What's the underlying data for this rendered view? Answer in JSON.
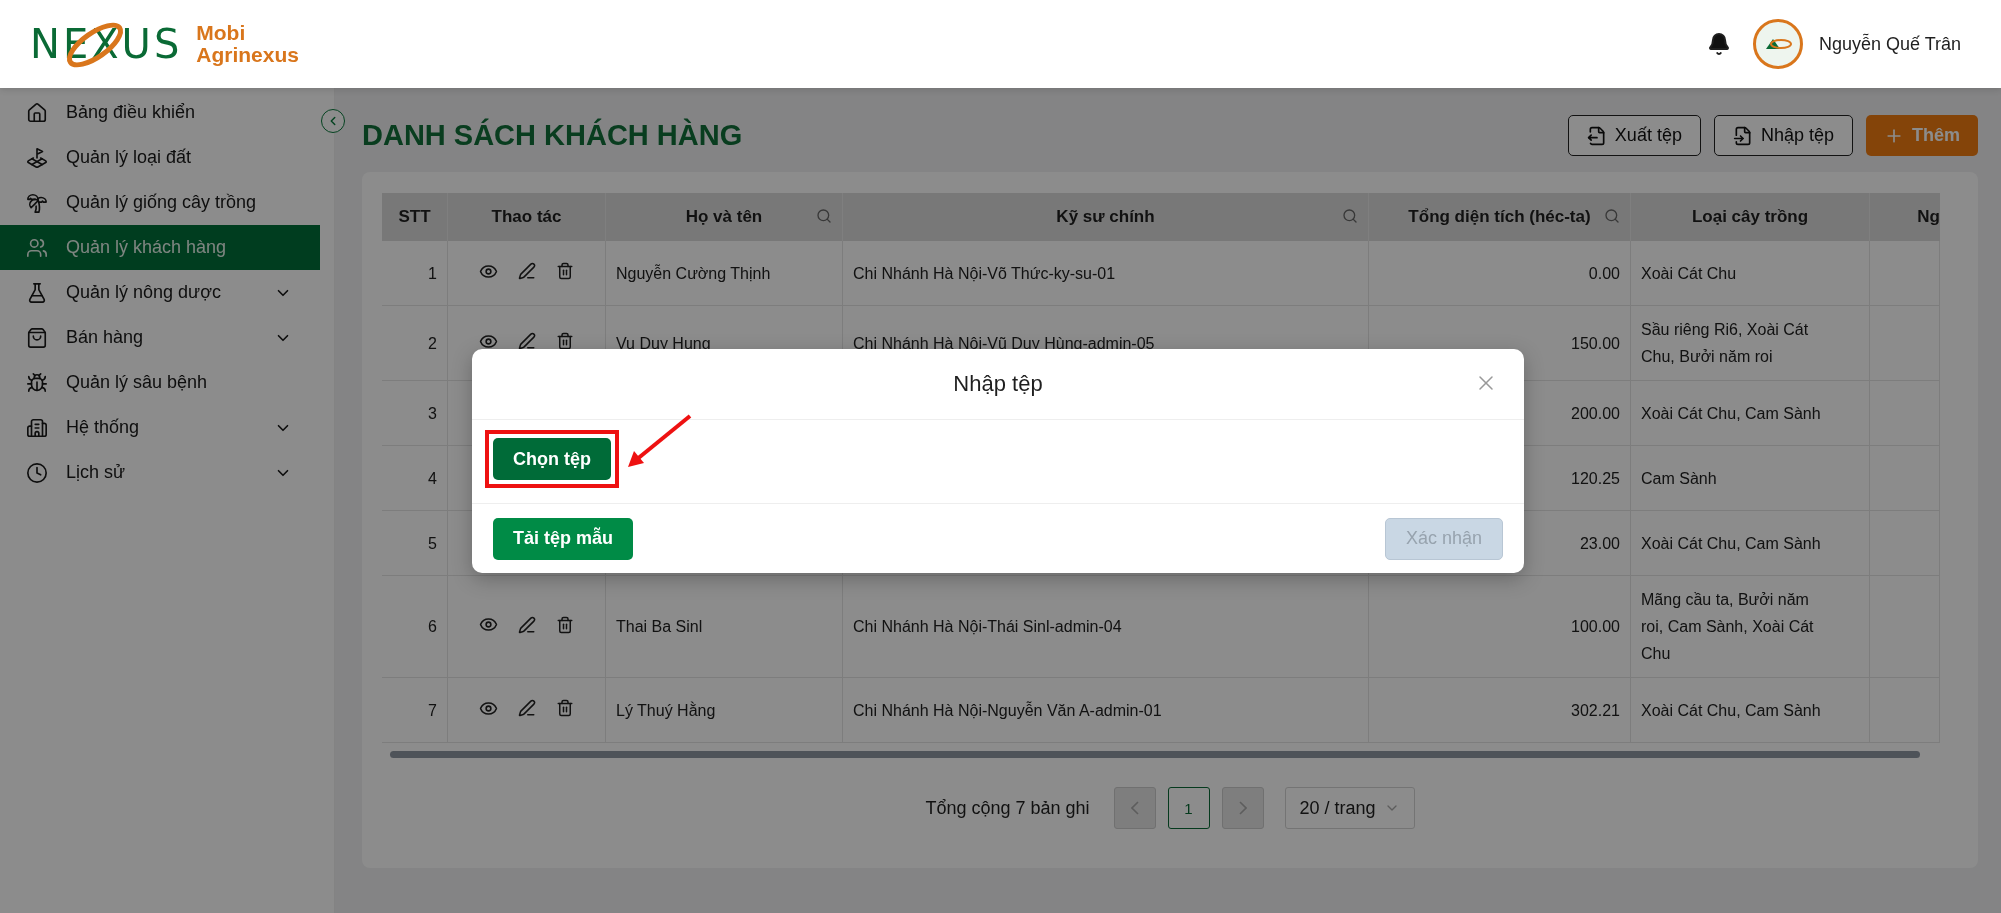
{
  "logo": {
    "wordmark": "NEXUS",
    "brand_line_1": "Mobi",
    "brand_line_2": "Agrinexus"
  },
  "header": {
    "user_name": "Nguyễn Quế Trân"
  },
  "sidebar": {
    "items": [
      {
        "label": "Bảng điều khiển",
        "kind": "home",
        "selected": false,
        "has_submenu": false
      },
      {
        "label": "Quản lý loại đất",
        "kind": "land",
        "selected": false,
        "has_submenu": false
      },
      {
        "label": "Quản lý giống cây trồng",
        "kind": "palm",
        "selected": false,
        "has_submenu": false
      },
      {
        "label": "Quản lý khách hàng",
        "kind": "users",
        "selected": true,
        "has_submenu": false
      },
      {
        "label": "Quản lý nông dược",
        "kind": "flask",
        "selected": false,
        "has_submenu": true
      },
      {
        "label": "Bán hàng",
        "kind": "bag",
        "selected": false,
        "has_submenu": true
      },
      {
        "label": "Quản lý sâu bệnh",
        "kind": "bug",
        "selected": false,
        "has_submenu": false
      },
      {
        "label": "Hệ thống",
        "kind": "building",
        "selected": false,
        "has_submenu": true
      },
      {
        "label": "Lịch sử",
        "kind": "clock",
        "selected": false,
        "has_submenu": true
      }
    ]
  },
  "page": {
    "title": "DANH SÁCH KHÁCH HÀNG",
    "actions": [
      {
        "label": "Xuất tệp",
        "kind": "export"
      },
      {
        "label": "Nhập tệp",
        "kind": "import"
      },
      {
        "label": "Thêm",
        "kind": "add"
      }
    ]
  },
  "table": {
    "columns": [
      {
        "label": "STT",
        "searchable": false
      },
      {
        "label": "Thao tác",
        "searchable": false
      },
      {
        "label": "Họ và tên",
        "searchable": true
      },
      {
        "label": "Kỹ sư chính",
        "searchable": true
      },
      {
        "label": "Tổng diện tích (héc-ta)",
        "searchable": true
      },
      {
        "label": "Loại cây trồng",
        "searchable": false
      },
      {
        "label": "Ng",
        "searchable": false
      }
    ],
    "rows": [
      {
        "stt": "1",
        "name": "Nguyễn Cường Thịnh",
        "engineer": "Chi Nhánh Hà Nội-Võ Thức-ky-su-01",
        "area": "0.00",
        "crops": "Xoài Cát Chu"
      },
      {
        "stt": "2",
        "name": "Vu Duy Hung",
        "engineer": "Chi Nhánh Hà Nội-Vũ Duy Hùng-admin-05",
        "area": "150.00",
        "crops": "Sầu riêng Ri6, Xoài Cát Chu, Bưởi năm roi"
      },
      {
        "stt": "3",
        "area": "200.00",
        "crops": "Xoài Cát Chu, Cam Sành"
      },
      {
        "stt": "4",
        "area": "120.25",
        "crops": "Cam Sành"
      },
      {
        "stt": "5",
        "area": "23.00",
        "crops": "Xoài Cát Chu, Cam Sành"
      },
      {
        "stt": "6",
        "name": "Thai Ba Sinl",
        "engineer": "Chi Nhánh Hà Nội-Thái Sinl-admin-04",
        "area": "100.00",
        "crops": "Mãng cầu ta, Bưởi năm roi, Cam Sành, Xoài Cát Chu"
      },
      {
        "stt": "7",
        "name": "Lý Thuý Hằng",
        "engineer": "Chi Nhánh Hà Nội-Nguyễn Văn A-admin-01",
        "area": "302.21",
        "crops": "Xoài Cát Chu, Cam Sành"
      }
    ]
  },
  "pagination": {
    "total": "Tổng cộng 7 bản ghi",
    "prev_disabled": true,
    "next_disabled": true,
    "pages": [
      {
        "label": "1",
        "selected": true
      }
    ],
    "page_size": "20 / trang"
  },
  "modal": {
    "title": "Nhập tệp",
    "choose_button": "Chọn tệp",
    "template_button": "Tải tệp mẫu",
    "confirm_button": {
      "label": "Xác nhận",
      "disabled": true
    }
  }
}
